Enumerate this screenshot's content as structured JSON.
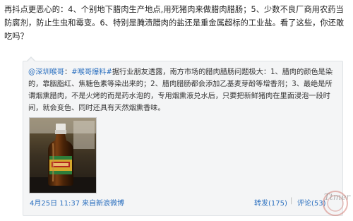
{
  "post": {
    "text": "再抖点更恶心的：4、个别地下腊肉生产地点,用死猪肉来做腊肉腊肠；5、少数不良厂商用农药当防腐剂，防止生虫和霉变。6、特别是腌渍腊肉的盐还是重金属超标的工业盐。看了这些，你还敢吃吗？"
  },
  "quote": {
    "author": "@深圳喉哥",
    "separator": "：",
    "topic": "#喉哥爆料#",
    "body": "据行业朋友透露，南方市场的腊肉腊肠问题极大：1、腊肉的颜色是染的，靠胭脂红、焦糖色素等染出来的；2、腊肉腊肠都会添加乙基麦芽酚等增香剂；3、最绝是所谓烟熏腊肉，不是火烤的而是药水泡的，专用烟熏液兑水后，只要把新鲜猪肉在里面浸泡一段时间，就会变色、同时还具有天然烟熏香味。"
  },
  "image": {
    "bottle_label": "烟熏液"
  },
  "footer": {
    "time": "4月25日 11:37",
    "source": "来自新浪微博",
    "forward": "转发(175)",
    "separator": "|",
    "comment": "评论(53)"
  },
  "watermark": {
    "text": "Ttmer"
  },
  "colors": {
    "link": "#2a6fbf",
    "quote_bg": "#f4f5f6",
    "quote_border": "#dfe3e6",
    "muted": "#8a8a8a"
  }
}
